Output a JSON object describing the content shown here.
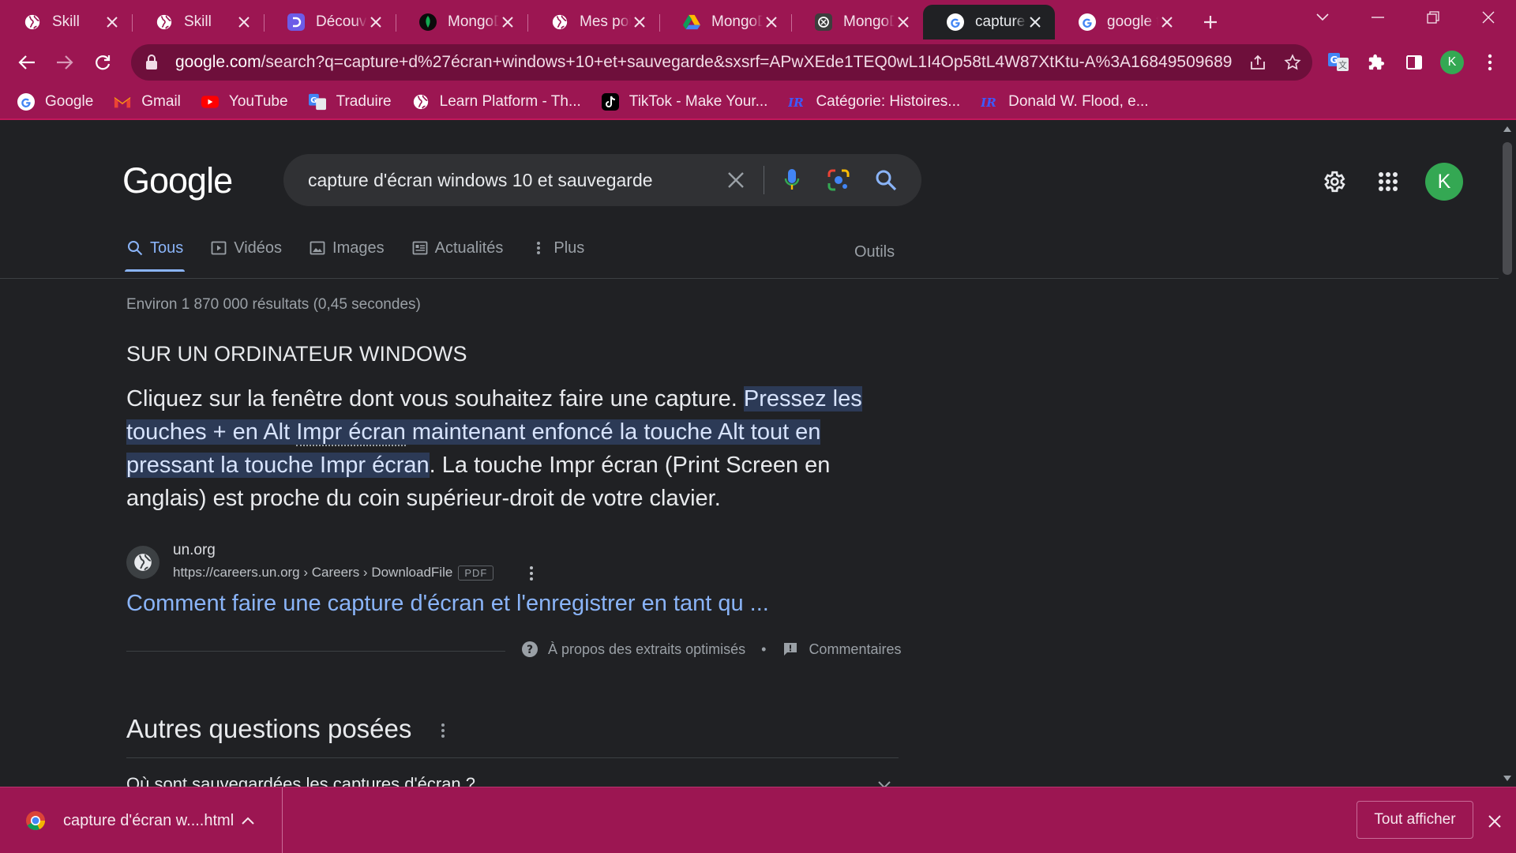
{
  "tabs": [
    {
      "title": "Skill",
      "icon": "globe-icon",
      "active": false
    },
    {
      "title": "Skill",
      "icon": "globe-icon",
      "active": false
    },
    {
      "title": "Découvrir",
      "icon": "purple-d-icon",
      "active": false
    },
    {
      "title": "MongoDB",
      "icon": "mongodb-leaf-icon",
      "active": false
    },
    {
      "title": "Mes points",
      "icon": "globe-icon",
      "active": false
    },
    {
      "title": "MongoDB",
      "icon": "google-drive-icon",
      "active": false
    },
    {
      "title": "MongoDB",
      "icon": "chatgpt-icon",
      "active": false
    },
    {
      "title": "capture d'écran",
      "icon": "google-g-icon",
      "active": true
    },
    {
      "title": "google tr",
      "icon": "google-g-icon",
      "active": false
    }
  ],
  "toolbar": {
    "url_host": "google.com",
    "url_path": "/search?q=capture+d%27écran+windows+10+et+sauvegarde&sxsrf=APwXEde1TEQ0wL1I4Op58tL4W87XtKtu-A%3A16849509689...",
    "profile_initial": "K"
  },
  "bookmarks": [
    {
      "label": "Google",
      "icon": "google-g-icon"
    },
    {
      "label": "Gmail",
      "icon": "gmail-icon"
    },
    {
      "label": "YouTube",
      "icon": "youtube-icon"
    },
    {
      "label": "Traduire",
      "icon": "translate-icon"
    },
    {
      "label": "Learn Platform - Th...",
      "icon": "globe-icon"
    },
    {
      "label": "TikTok - Make Your...",
      "icon": "tiktok-icon"
    },
    {
      "label": "Catégorie: Histoires...",
      "icon": "fandom-icon"
    },
    {
      "label": "Donald W. Flood, e...",
      "icon": "fandom-icon"
    }
  ],
  "search": {
    "logo": "Google",
    "query": "capture d'écran windows 10 et sauvegarde",
    "avatar_initial": "K"
  },
  "search_tabs": [
    {
      "label": "Tous",
      "icon": "search-icon",
      "active": true
    },
    {
      "label": "Vidéos",
      "icon": "video-icon",
      "active": false
    },
    {
      "label": "Images",
      "icon": "image-icon",
      "active": false
    },
    {
      "label": "Actualités",
      "icon": "news-icon",
      "active": false
    },
    {
      "label": "Plus",
      "icon": "more-vertical-icon",
      "active": false
    }
  ],
  "tools_label": "Outils",
  "results": {
    "stats": "Environ 1 870 000 résultats (0,45 secondes)",
    "snippet_heading": "SUR UN ORDINATEUR WINDOWS",
    "snippet_part1": "Cliquez sur la fenêtre dont vous souhaitez faire une capture. ",
    "snippet_highlight_a": "Pressez les touches + en Alt ",
    "snippet_highlight_b": "Impr écran",
    "snippet_highlight_c": " maintenant enfoncé la touche Alt tout en pressant la touche Impr écran",
    "snippet_part2": ". La touche Impr écran (Print Screen en anglais) est proche du coin supérieur-droit de votre clavier.",
    "source_name": "un.org",
    "source_url": "https://careers.un.org › Careers › DownloadFile",
    "source_badge": "PDF",
    "result_title": "Comment faire une capture d'écran et l'enregistrer en tant qu ...",
    "about_label": "À propos des extraits optimisés",
    "about_separator": "•",
    "feedback_label": "Commentaires",
    "paa_title": "Autres questions posées",
    "paa_question": "Où sont sauvegardées les captures d'écran ?"
  },
  "download": {
    "file_name": "capture d'écran w....html",
    "show_all": "Tout afficher"
  },
  "colors": {
    "chrome_theme": "#9c1652",
    "page_bg": "#202124",
    "link_blue": "#8ab4f8",
    "highlight": "#2c3a56"
  }
}
